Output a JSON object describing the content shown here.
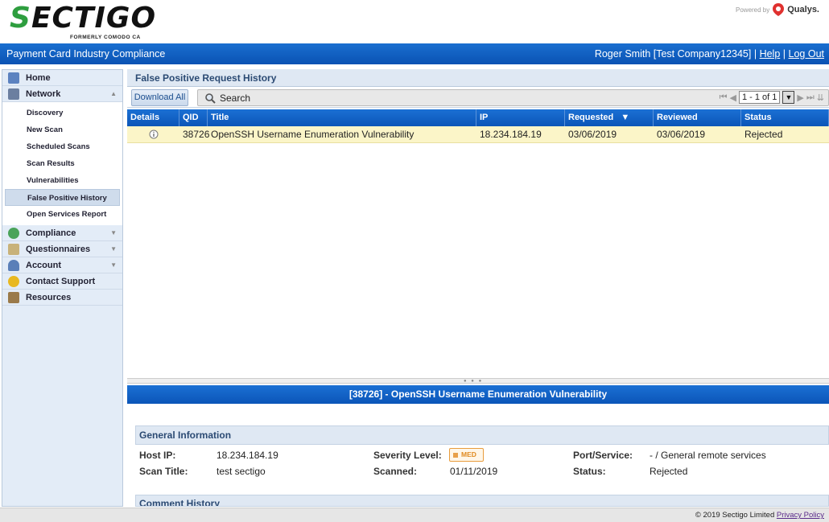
{
  "brand": {
    "logo_text": "SECTIGO",
    "logo_sub": "FORMERLY COMODO CA",
    "powered_by": "Powered by",
    "qualys": "Qualys."
  },
  "header": {
    "app_title": "Payment Card Industry Compliance",
    "user": "Roger Smith [Test Company12345]",
    "sep": "|",
    "help": "Help",
    "logout": "Log Out"
  },
  "sidebar": {
    "home": "Home",
    "network": "Network",
    "network_items": [
      "Discovery",
      "New Scan",
      "Scheduled Scans",
      "Scan Results",
      "Vulnerabilities",
      "False Positive History",
      "Open Services Report"
    ],
    "compliance": "Compliance",
    "questionnaires": "Questionnaires",
    "account": "Account",
    "contact": "Contact Support",
    "resources": "Resources"
  },
  "panel": {
    "title": "False Positive Request History",
    "download_all": "Download All",
    "search": "Search",
    "pager": "1 - 1 of 1"
  },
  "grid": {
    "columns": [
      "Details",
      "QID",
      "Title",
      "IP",
      "Requested",
      "Reviewed",
      "Status"
    ],
    "rows": [
      {
        "qid": "38726",
        "title": "OpenSSH Username Enumeration Vulnerability",
        "ip": "18.234.184.19",
        "requested": "03/06/2019",
        "reviewed": "03/06/2019",
        "status": "Rejected"
      }
    ]
  },
  "detail": {
    "title": "[38726] - OpenSSH Username Enumeration Vulnerability",
    "general_heading": "General Information",
    "host_ip_label": "Host IP:",
    "host_ip": "18.234.184.19",
    "scan_title_label": "Scan Title:",
    "scan_title": "test sectigo",
    "severity_label": "Severity Level:",
    "severity": "MED",
    "scanned_label": "Scanned:",
    "scanned": "01/11/2019",
    "port_label": "Port/Service:",
    "port": "- / General remote services",
    "status_label": "Status:",
    "status": "Rejected",
    "comment_heading": "Comment History"
  },
  "footer": {
    "copyright": "© 2019 Sectigo Limited",
    "privacy": "Privacy Policy"
  },
  "colors": {
    "accent_blue": "#0b55b8",
    "row_highlight": "#fbf5c8",
    "sectigo_green": "#2e9e3f"
  }
}
